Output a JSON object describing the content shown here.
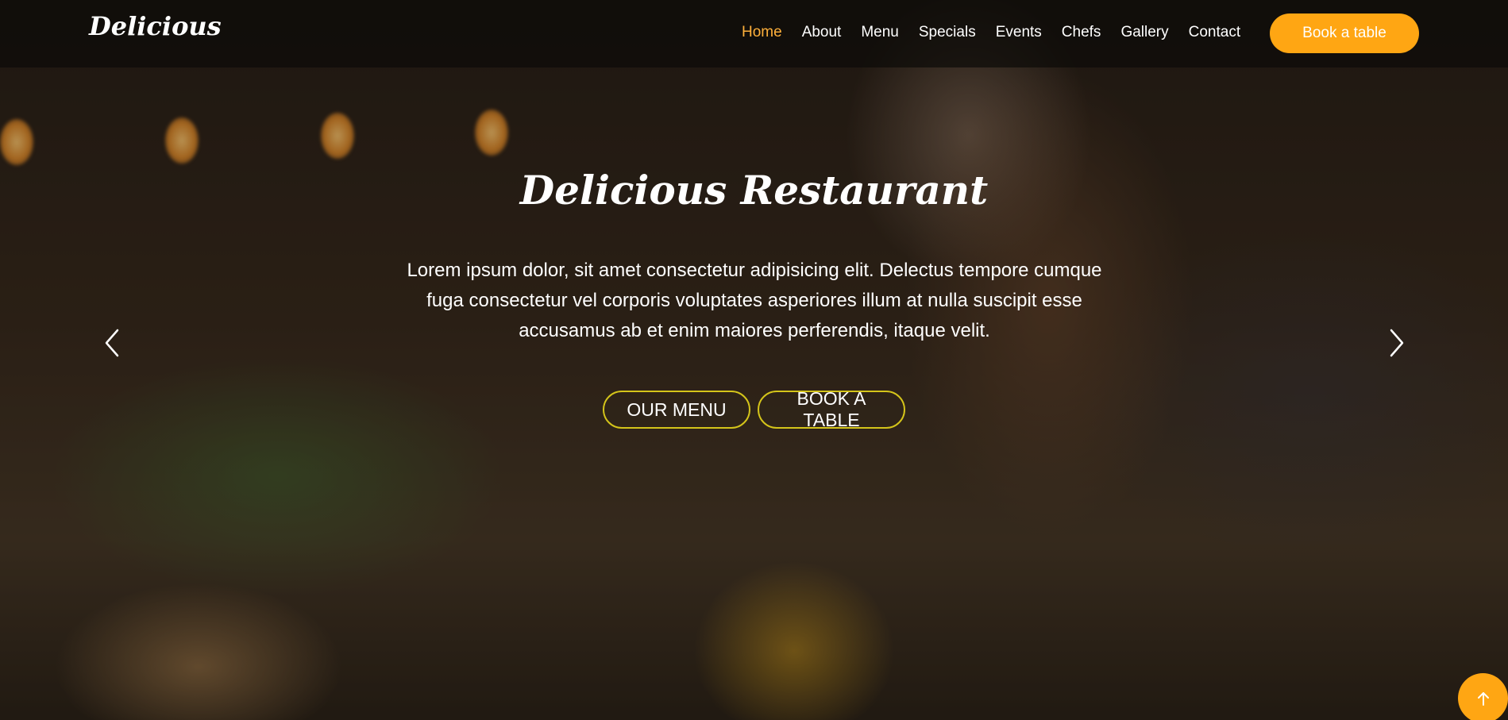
{
  "brand": {
    "logo": "Delicious"
  },
  "nav": {
    "items": [
      {
        "label": "Home",
        "active": true
      },
      {
        "label": "About"
      },
      {
        "label": "Menu"
      },
      {
        "label": "Specials"
      },
      {
        "label": "Events"
      },
      {
        "label": "Chefs"
      },
      {
        "label": "Gallery"
      },
      {
        "label": "Contact"
      }
    ],
    "book_button": "Book a table"
  },
  "hero": {
    "title": "Delicious Restaurant",
    "description": "Lorem ipsum dolor, sit amet consectetur adipisicing elit. Delectus tempore cumque fuga consectetur vel corporis voluptates asperiores illum at nulla suscipit esse accusamus ab et enim maiores perferendis, itaque velit.",
    "buttons": {
      "menu": "OUR MENU",
      "book": "BOOK A TABLE"
    },
    "carousel_prev_icon": "chevron-left-icon",
    "carousel_next_icon": "chevron-right-icon"
  },
  "back_to_top_icon": "arrow-up-icon",
  "colors": {
    "accent": "#ffa613",
    "active_nav": "#ffb03b",
    "cta_border": "#d4c41a",
    "text": "#ffffff"
  }
}
